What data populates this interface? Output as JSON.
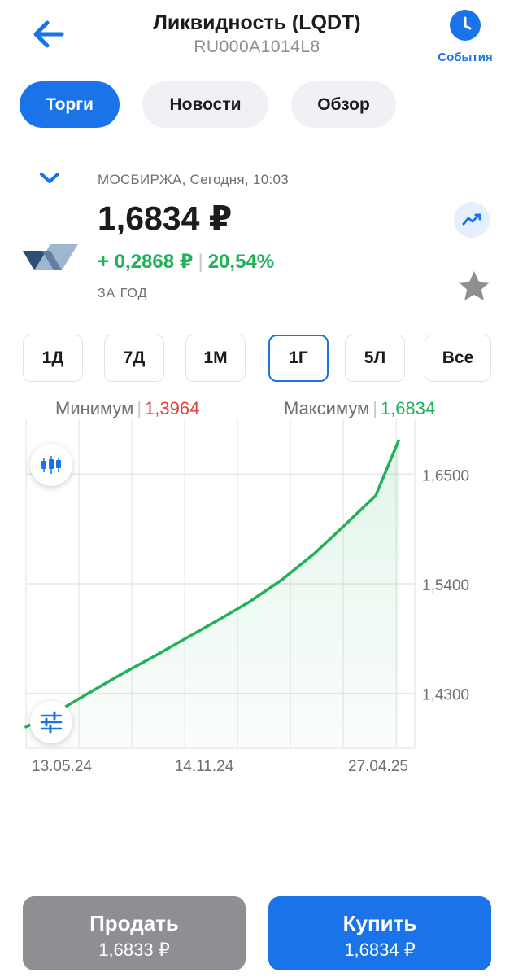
{
  "header": {
    "title": "Ликвидность (LQDT)",
    "isin": "RU000A1014L8",
    "events_label": "События"
  },
  "tabs": [
    {
      "label": "Торги",
      "active": true
    },
    {
      "label": "Новости",
      "active": false
    },
    {
      "label": "Обзор",
      "active": false
    }
  ],
  "quote": {
    "exchange_time": "МОСБИРЖА, Сегодня, 10:03",
    "price": "1,6834 ₽",
    "change_abs": "+ 0,2868 ₽",
    "change_pct": "20,54%",
    "period_label": "ЗА ГОД"
  },
  "periods": [
    {
      "label": "1Д",
      "active": false
    },
    {
      "label": "7Д",
      "active": false
    },
    {
      "label": "1М",
      "active": false
    },
    {
      "label": "1Г",
      "active": true
    },
    {
      "label": "5Л",
      "active": false
    },
    {
      "label": "Все",
      "active": false
    }
  ],
  "minmax": {
    "min_label": "Минимум",
    "min_value": "1,3964",
    "max_label": "Максимум",
    "max_value": "1,6834"
  },
  "chart_data": {
    "type": "area",
    "x_tick_labels": [
      "13.05.24",
      "14.11.24",
      "27.04.25"
    ],
    "y_tick_labels": [
      "1,6500",
      "1,5400",
      "1,4300"
    ],
    "y_ticks": [
      1.65,
      1.54,
      1.43
    ],
    "ylim": [
      1.375,
      1.705
    ],
    "x": [
      "2024-05-13",
      "2024-06-13",
      "2024-07-13",
      "2024-08-13",
      "2024-09-13",
      "2024-10-13",
      "2024-11-14",
      "2024-12-14",
      "2025-01-14",
      "2025-02-14",
      "2025-03-14",
      "2025-04-14",
      "2025-05-06"
    ],
    "values": [
      1.3964,
      1.4124,
      1.4308,
      1.4495,
      1.4671,
      1.4849,
      1.5037,
      1.522,
      1.5441,
      1.5702,
      1.5975,
      1.6284,
      1.6834
    ],
    "color": "#20b25a",
    "grid": true
  },
  "actions": {
    "sell_label": "Продать",
    "sell_price": "1,6833 ₽",
    "buy_label": "Купить",
    "buy_price": "1,6834 ₽"
  },
  "colors": {
    "accent": "#1a73e8",
    "positive": "#20b25a",
    "negative": "#e2433c",
    "sell_bg": "#8e8e93"
  }
}
